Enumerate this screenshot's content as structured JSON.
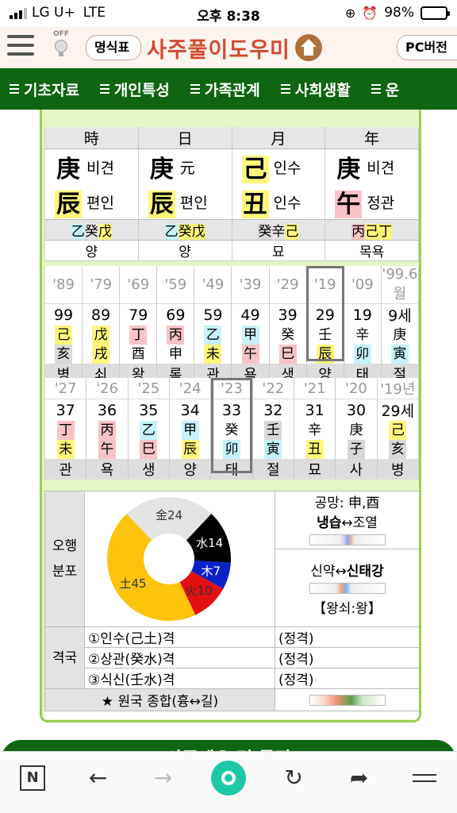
{
  "status_bar": {
    "carrier": "LG U+",
    "network": "LTE",
    "time": "오후 8:38",
    "battery": "98%"
  },
  "header": {
    "bulb_label": "OFF",
    "left_button": "명식표",
    "logo": "사주풀이도우미",
    "right_button": "PC버전"
  },
  "nav": {
    "items": [
      "기초자료",
      "개인특성",
      "가족관계",
      "사회생활",
      "운"
    ]
  },
  "pillars": {
    "headers": [
      "時",
      "日",
      "月",
      "年"
    ],
    "stems": [
      {
        "char": "庚",
        "label": "비견",
        "color": "#ffffff"
      },
      {
        "char": "庚",
        "label": "元",
        "color": "#ffffff"
      },
      {
        "char": "己",
        "label": "인수",
        "color": "#fff77b"
      },
      {
        "char": "庚",
        "label": "비견",
        "color": "#ffffff"
      }
    ],
    "branches": [
      {
        "char": "辰",
        "label": "편인",
        "color": "#fff77b"
      },
      {
        "char": "辰",
        "label": "편인",
        "color": "#fff77b"
      },
      {
        "char": "丑",
        "label": "인수",
        "color": "#fff77b"
      },
      {
        "char": "午",
        "label": "정관",
        "color": "#f9c3c7"
      }
    ],
    "hidden": [
      [
        {
          "t": "乙",
          "c": "#c6f2fa"
        },
        {
          "t": "癸",
          "c": "#ffffff"
        },
        {
          "t": "戊",
          "c": "#fff77b"
        }
      ],
      [
        {
          "t": "乙",
          "c": "#c6f2fa"
        },
        {
          "t": "癸",
          "c": "#fff77b"
        },
        {
          "t": "戊",
          "c": "#fff77b"
        }
      ],
      [
        {
          "t": "癸",
          "c": "#d8d8d8"
        },
        {
          "t": "辛",
          "c": "#ffffff"
        },
        {
          "t": "己",
          "c": "#fff77b"
        }
      ],
      [
        {
          "t": "丙",
          "c": "#f9c3c7"
        },
        {
          "t": "己",
          "c": "#fff77b"
        },
        {
          "t": "丁",
          "c": "#fff77b"
        }
      ]
    ],
    "stages": [
      "양",
      "양",
      "묘",
      "목욕"
    ]
  },
  "daewoon": {
    "years": [
      "'89",
      "'79",
      "'69",
      "'59",
      "'49",
      "'39",
      "'29",
      "'19",
      "'09",
      "'99.6월"
    ],
    "ages": [
      "99",
      "89",
      "79",
      "69",
      "59",
      "49",
      "39",
      "29",
      "19",
      "9세"
    ],
    "stems": [
      {
        "t": "己",
        "c": "#fff77b"
      },
      {
        "t": "戊",
        "c": "#fff77b"
      },
      {
        "t": "丁",
        "c": "#f9c3c7"
      },
      {
        "t": "丙",
        "c": "#f9c3c7"
      },
      {
        "t": "乙",
        "c": "#c6f2fa"
      },
      {
        "t": "甲",
        "c": "#c6f2fa"
      },
      {
        "t": "癸",
        "c": "#ffffff"
      },
      {
        "t": "壬",
        "c": "#ffffff"
      },
      {
        "t": "辛",
        "c": "#ffffff"
      },
      {
        "t": "庚",
        "c": "#ffffff"
      }
    ],
    "branches": [
      {
        "t": "亥",
        "c": "#d8d8d8"
      },
      {
        "t": "戌",
        "c": "#fff77b"
      },
      {
        "t": "酉",
        "c": "#ffffff"
      },
      {
        "t": "申",
        "c": "#ffffff"
      },
      {
        "t": "未",
        "c": "#fff77b"
      },
      {
        "t": "午",
        "c": "#f9c3c7"
      },
      {
        "t": "巳",
        "c": "#f9c3c7"
      },
      {
        "t": "辰",
        "c": "#fff77b"
      },
      {
        "t": "卯",
        "c": "#c6f2fa"
      },
      {
        "t": "寅",
        "c": "#c6f2fa"
      }
    ],
    "stages": [
      "병",
      "쇠",
      "왕",
      "록",
      "관",
      "욕",
      "생",
      "양",
      "태",
      "절"
    ]
  },
  "seun": {
    "years": [
      "'27",
      "'26",
      "'25",
      "'24",
      "'23",
      "'22",
      "'21",
      "'20",
      "'19년"
    ],
    "ages": [
      "37",
      "36",
      "35",
      "34",
      "33",
      "32",
      "31",
      "30",
      "29세"
    ],
    "stems": [
      {
        "t": "丁",
        "c": "#f9c3c7"
      },
      {
        "t": "丙",
        "c": "#f9c3c7"
      },
      {
        "t": "乙",
        "c": "#c6f2fa"
      },
      {
        "t": "甲",
        "c": "#c6f2fa"
      },
      {
        "t": "癸",
        "c": "#ffffff"
      },
      {
        "t": "壬",
        "c": "#d8d8d8"
      },
      {
        "t": "辛",
        "c": "#ffffff"
      },
      {
        "t": "庚",
        "c": "#ffffff"
      },
      {
        "t": "己",
        "c": "#fff77b"
      }
    ],
    "branches": [
      {
        "t": "未",
        "c": "#fff77b"
      },
      {
        "t": "午",
        "c": "#f9c3c7"
      },
      {
        "t": "巳",
        "c": "#f9c3c7"
      },
      {
        "t": "辰",
        "c": "#fff77b"
      },
      {
        "t": "卯",
        "c": "#c6f2fa"
      },
      {
        "t": "寅",
        "c": "#c6f2fa"
      },
      {
        "t": "丑",
        "c": "#fff77b"
      },
      {
        "t": "子",
        "c": "#d8d8d8"
      },
      {
        "t": "亥",
        "c": "#d8d8d8"
      }
    ],
    "stages": [
      "관",
      "욕",
      "생",
      "양",
      "태",
      "절",
      "묘",
      "사",
      "병"
    ]
  },
  "ohang": {
    "label_1": "오행",
    "label_2": "분포",
    "segments": [
      {
        "name": "金",
        "value": 24,
        "color": "#e4e4e4"
      },
      {
        "name": "水",
        "value": 14,
        "color": "#000000"
      },
      {
        "name": "木",
        "value": 7,
        "color": "#0a21c8"
      },
      {
        "name": "火",
        "value": 10,
        "color": "#e21010"
      },
      {
        "name": "土",
        "value": 45,
        "color": "#fdc40b"
      }
    ],
    "gongmang": "공망: 申,酉",
    "naengseup_bold": "냉습",
    "naengseup_rest": "↔조열",
    "sinyak": "신약↔",
    "sintaegang": "신태강",
    "wangsoe": "【왕쇠:왕】"
  },
  "gyeokguk": {
    "label": "격국",
    "items": [
      {
        "name": "①인수(己土)격",
        "type": "(정격)"
      },
      {
        "name": "②상관(癸水)격",
        "type": "(정격)"
      },
      {
        "name": "③식신(壬水)격",
        "type": "(정격)"
      }
    ],
    "overall": "★ 원국 종합(흉↔길)"
  },
  "banner": {
    "text": "사주괘요 및 특징"
  }
}
